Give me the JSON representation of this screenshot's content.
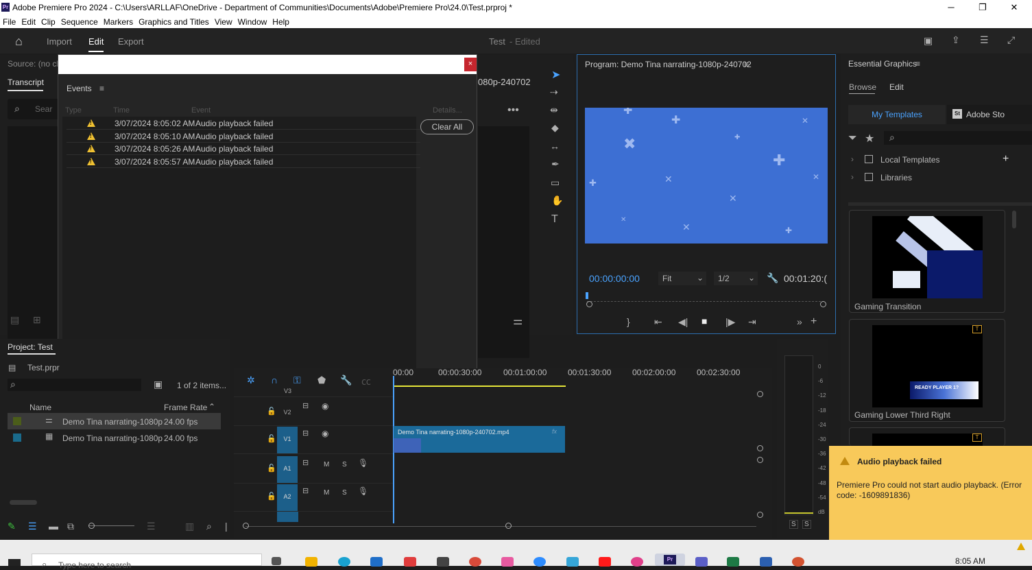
{
  "window": {
    "title": "Adobe Premiere Pro 2024 - C:\\Users\\ARLLAF\\OneDrive - Department of Communities\\Documents\\Adobe\\Premiere Pro\\24.0\\Test.prproj *",
    "minimize": "─",
    "maximize": "❐",
    "close": "✕",
    "app_badge": "Pr"
  },
  "menu": [
    "File",
    "Edit",
    "Clip",
    "Sequence",
    "Markers",
    "Graphics and Titles",
    "View",
    "Window",
    "Help"
  ],
  "header": {
    "tabs": [
      "Import",
      "Edit",
      "Export"
    ],
    "active": "Edit",
    "project_name": "Test",
    "project_state": "- Edited"
  },
  "source": {
    "label": "Source: (no cli",
    "tab": "Transcript",
    "search_placeholder": "Sear",
    "clip_name": "080p-240702"
  },
  "events": {
    "title": "Events",
    "menu_icon": "≡",
    "columns": [
      "Type",
      "Time",
      "Event"
    ],
    "details_button": "Details...",
    "clear_all": "Clear All",
    "rows": [
      {
        "time": "3/07/2024 8:05:02 AM",
        "event": "Audio playback failed"
      },
      {
        "time": "3/07/2024 8:05:10 AM",
        "event": "Audio playback failed"
      },
      {
        "time": "3/07/2024 8:05:26 AM",
        "event": "Audio playback failed"
      },
      {
        "time": "3/07/2024 8:05:57 AM",
        "event": "Audio playback failed"
      }
    ],
    "close": "×"
  },
  "program": {
    "title": "Program: Demo Tina narrating-1080p-240702",
    "timecode": "00:00:00:00",
    "fit": "Fit",
    "res": "1/2",
    "duration": "00:01:20:("
  },
  "essential": {
    "title": "Essential Graphics",
    "tabs": [
      "Browse",
      "Edit"
    ],
    "subtabs": [
      "My Templates",
      "Adobe Sto"
    ],
    "tree": [
      "Local Templates",
      "Libraries"
    ],
    "templates": [
      "Gaming Transition",
      "Gaming Lower Third Right"
    ],
    "ready_text": "READY PLAYER 1?"
  },
  "project": {
    "tab": "Project: Test",
    "file": "Test.prpr",
    "count": "1 of 2 items...",
    "columns": [
      "Name",
      "Frame Rate"
    ],
    "items": [
      {
        "name": "Demo Tina narrating-1080p",
        "fps": "24.00 fps",
        "color": "#4b5d1a"
      },
      {
        "name": "Demo Tina narrating-1080p",
        "fps": "24.00 fps",
        "color": "#1a6b8c"
      }
    ]
  },
  "timeline": {
    "ruler": [
      "00:00",
      "00:00:30:00",
      "00:01:00:00",
      "00:01:30:00",
      "00:02:00:00",
      "00:02:30:00"
    ],
    "tracks": [
      "V3",
      "V2",
      "V1",
      "A1",
      "A2"
    ],
    "clip": "Demo Tina narrating-1080p-240702.mp4",
    "fx": "fx",
    "track_toggles": [
      "M",
      "S"
    ]
  },
  "meter": {
    "scale": [
      "0",
      "-6",
      "-12",
      "-18",
      "-24",
      "-30",
      "-36",
      "-42",
      "-48",
      "-54",
      "dB"
    ],
    "solo": [
      "S",
      "S"
    ]
  },
  "toast": {
    "title": "Audio playback failed",
    "body": "Premiere Pro could not start audio playback. (Error code: -1609891836)"
  },
  "taskbar": {
    "search_placeholder": "Type here to search",
    "time": "8:05 AM"
  }
}
